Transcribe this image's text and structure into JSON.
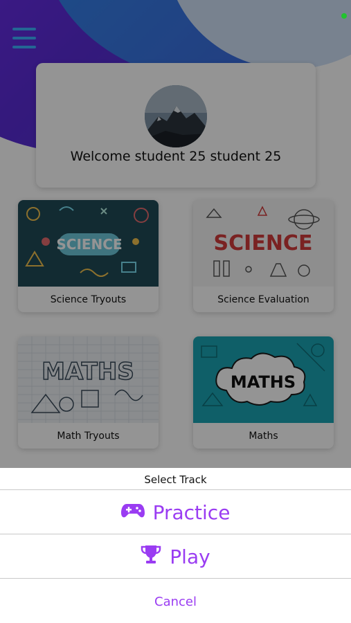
{
  "status": {
    "indicator_color": "#22c32e"
  },
  "menu": {
    "icon": "hamburger-menu-icon",
    "color": "#3fb0ff"
  },
  "welcome": {
    "text": "Welcome student 25 student 25"
  },
  "courses": [
    {
      "label": "Science Tryouts",
      "thumb_text": "SCIENCE",
      "thumb_bg": "#1f4b57"
    },
    {
      "label": "Science Evaluation",
      "thumb_text": "SCIENCE",
      "thumb_bg": "#f4f4f4"
    },
    {
      "label": "Math Tryouts",
      "thumb_text": "MATHS",
      "thumb_bg": "#eef2f5"
    },
    {
      "label": "Maths",
      "thumb_text": "MATHS",
      "thumb_bg": "#1aa4b3"
    }
  ],
  "sheet": {
    "title": "Select Track",
    "options": [
      {
        "label": "Practice",
        "icon": "gamepad-icon"
      },
      {
        "label": "Play",
        "icon": "trophy-icon"
      }
    ],
    "cancel_label": "Cancel",
    "accent_color": "#9a3cf2"
  }
}
